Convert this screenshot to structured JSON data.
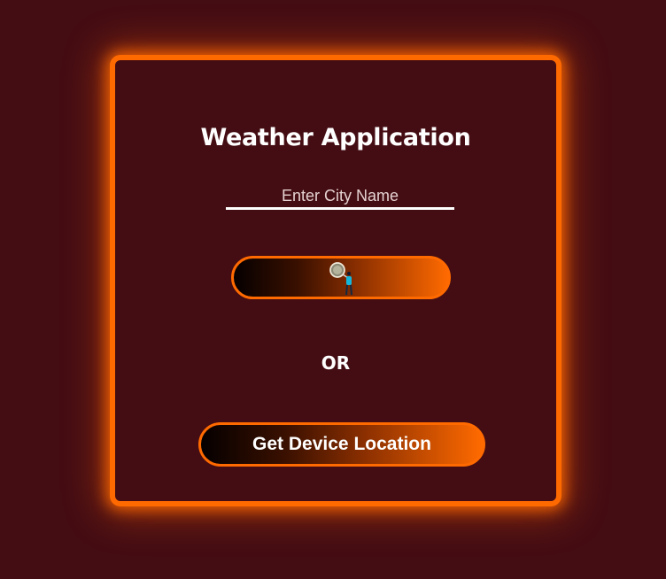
{
  "app": {
    "title": "Weather Application"
  },
  "search": {
    "placeholder": "Enter City Name",
    "button_icon": "search-person-icon"
  },
  "divider": {
    "text": "OR"
  },
  "location": {
    "button_label": "Get Device Location"
  },
  "colors": {
    "background": "#440d13",
    "accent": "#ff6a00",
    "text": "#ffffff"
  }
}
